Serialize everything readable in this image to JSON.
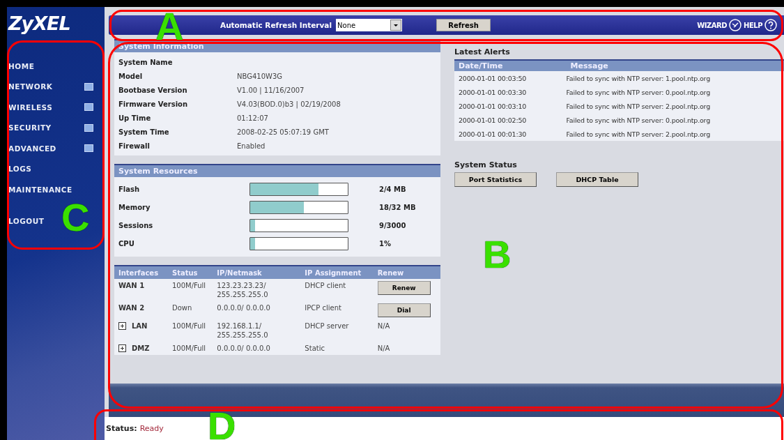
{
  "logo": "ZyXEL",
  "sidebar": {
    "items": [
      {
        "label": "HOME",
        "expandable": false
      },
      {
        "label": "NETWORK",
        "expandable": true
      },
      {
        "label": "WIRELESS",
        "expandable": true
      },
      {
        "label": "SECURITY",
        "expandable": true
      },
      {
        "label": "ADVANCED",
        "expandable": true
      },
      {
        "label": "LOGS",
        "expandable": false
      },
      {
        "label": "MAINTENANCE",
        "expandable": false
      },
      {
        "label": "LOGOUT",
        "expandable": false
      }
    ]
  },
  "toolbar": {
    "refresh_label": "Automatic Refresh Interval",
    "interval": "None",
    "refresh_button": "Refresh",
    "wizard": "WIZARD",
    "help": "HELP"
  },
  "system_information": {
    "title": "System Information",
    "rows": [
      {
        "label": "System Name",
        "value": ""
      },
      {
        "label": "Model",
        "value": "NBG410W3G"
      },
      {
        "label": "Bootbase Version",
        "value": "V1.00 | 11/16/2007"
      },
      {
        "label": "Firmware Version",
        "value": "V4.03(BOD.0)b3 | 02/19/2008"
      },
      {
        "label": "Up Time",
        "value": "01:12:07"
      },
      {
        "label": "System Time",
        "value": "2008-02-25 05:07:19 GMT"
      },
      {
        "label": "Firewall",
        "value": "Enabled"
      }
    ]
  },
  "system_resources": {
    "title": "System Resources",
    "meters": [
      {
        "label": "Flash",
        "level": 0.7,
        "reading": "2/4 MB"
      },
      {
        "label": "Memory",
        "level": 0.55,
        "reading": "18/32 MB"
      },
      {
        "label": "Sessions",
        "level": 0.05,
        "reading": "9/3000"
      },
      {
        "label": "CPU",
        "level": 0.05,
        "reading": "1%"
      }
    ]
  },
  "interfaces": {
    "columns": [
      "Interfaces",
      "Status",
      "IP/Netmask",
      "IP Assignment",
      "Renew"
    ],
    "rows": [
      {
        "name": "WAN 1",
        "expander": false,
        "status": "100M/Full",
        "ip": "123.23.23.23/ 255.255.255.0",
        "assignment": "DHCP client",
        "renew": {
          "kind": "button",
          "label": "Renew"
        }
      },
      {
        "name": "WAN 2",
        "expander": false,
        "status": "Down",
        "ip": "0.0.0.0/ 0.0.0.0",
        "assignment": "IPCP client",
        "renew": {
          "kind": "button",
          "label": "Dial"
        }
      },
      {
        "name": "LAN",
        "expander": true,
        "status": "100M/Full",
        "ip": "192.168.1.1/ 255.255.255.0",
        "assignment": "DHCP server",
        "renew": {
          "kind": "text",
          "label": "N/A"
        }
      },
      {
        "name": "DMZ",
        "expander": true,
        "status": "100M/Full",
        "ip": "0.0.0.0/ 0.0.0.0",
        "assignment": "Static",
        "renew": {
          "kind": "text",
          "label": "N/A"
        }
      }
    ]
  },
  "latest_alerts": {
    "title": "Latest Alerts",
    "columns": [
      "Date/Time",
      "Message"
    ],
    "rows": [
      {
        "time": "2000-01-01 00:03:50",
        "message": "Failed to sync with NTP server: 1.pool.ntp.org"
      },
      {
        "time": "2000-01-01 00:03:30",
        "message": "Failed to sync with NTP server: 0.pool.ntp.org"
      },
      {
        "time": "2000-01-01 00:03:10",
        "message": "Failed to sync with NTP server: 2.pool.ntp.org"
      },
      {
        "time": "2000-01-01 00:02:50",
        "message": "Failed to sync with NTP server: 0.pool.ntp.org"
      },
      {
        "time": "2000-01-01 00:01:30",
        "message": "Failed to sync with NTP server: 2.pool.ntp.org"
      }
    ]
  },
  "system_status": {
    "title": "System Status",
    "buttons": [
      "Port Statistics",
      "DHCP Table"
    ]
  },
  "status_bar": {
    "label": "Status:",
    "value": "Ready"
  },
  "callouts": [
    {
      "label": "A"
    },
    {
      "label": "B"
    },
    {
      "label": "C"
    },
    {
      "label": "D"
    }
  ]
}
